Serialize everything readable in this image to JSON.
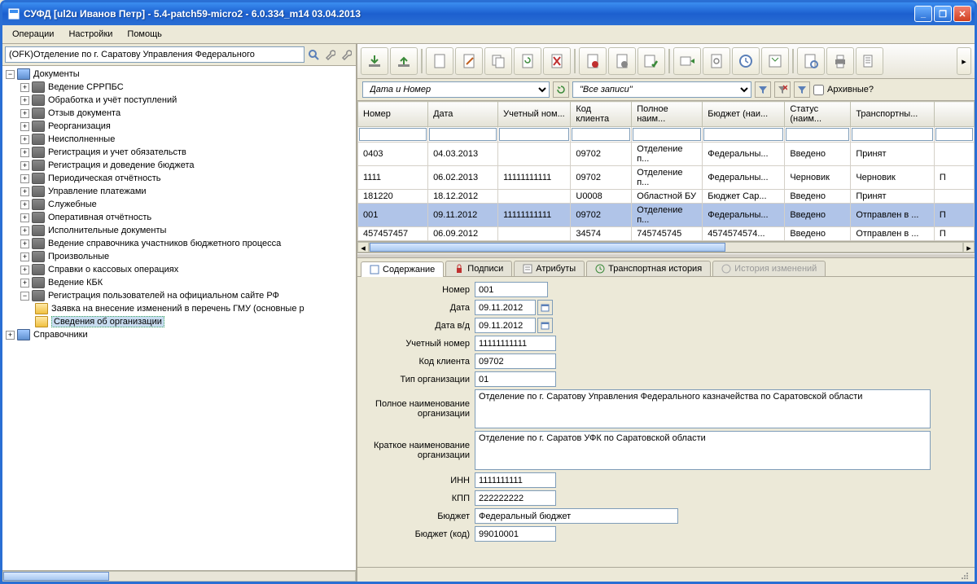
{
  "window": {
    "title": "СУФД [ul2u Иванов Петр] - 5.4-patch59-micro2 - 6.0.334_m14 03.04.2013"
  },
  "menu": {
    "items": [
      "Операции",
      "Настройки",
      "Помощь"
    ]
  },
  "nav": {
    "breadcrumb": "(OFK)Отделение по г. Саратову Управления Федерального",
    "tree": {
      "root0": {
        "label": "Документы"
      },
      "items": [
        {
          "label": "Ведение СРРПБС"
        },
        {
          "label": "Обработка и учёт поступлений"
        },
        {
          "label": "Отзыв документа"
        },
        {
          "label": "Реорганизация"
        },
        {
          "label": "Неисполненные"
        },
        {
          "label": "Регистрация и учет обязательств"
        },
        {
          "label": "Регистрация и доведение бюджета"
        },
        {
          "label": "Периодическая отчётность"
        },
        {
          "label": "Управление платежами"
        },
        {
          "label": "Служебные"
        },
        {
          "label": "Оперативная отчётность"
        },
        {
          "label": "Исполнительные документы"
        },
        {
          "label": "Ведение справочника участников бюджетного процесса"
        },
        {
          "label": "Произвольные"
        },
        {
          "label": "Справки о кассовых операциях"
        },
        {
          "label": "Ведение КБК"
        },
        {
          "label": "Регистрация пользователей на официальном сайте РФ"
        }
      ],
      "subitems": [
        {
          "label": "Заявка на внесение изменений в перечень ГМУ (основные р"
        },
        {
          "label": "Сведения об организации"
        }
      ],
      "root1": {
        "label": "Справочники"
      }
    }
  },
  "filter": {
    "by": "Дата и Номер",
    "preset": "\"Все записи\"",
    "archive_label": "Архивные?"
  },
  "grid": {
    "cols": [
      "Номер",
      "Дата",
      "Учетный ном...",
      "Код клиента",
      "Полное наим...",
      "Бюджет (наи...",
      "Статус (наим...",
      "Транспортны..."
    ],
    "rows": [
      {
        "num": "0403",
        "date": "04.03.2013",
        "acct": "",
        "client": "09702",
        "name": "Отделение п...",
        "budget": "Федеральны...",
        "status": "Введено",
        "trans": "Принят",
        "e": ""
      },
      {
        "num": "1111",
        "date": "06.02.2013",
        "acct": "11111111111",
        "client": "09702",
        "name": "Отделение п...",
        "budget": "Федеральны...",
        "status": "Черновик",
        "trans": "Черновик",
        "e": "П"
      },
      {
        "num": "181220",
        "date": "18.12.2012",
        "acct": "",
        "client": "U0008",
        "name": "Областной БУ",
        "budget": "Бюджет Сар...",
        "status": "Введено",
        "trans": "Принят",
        "e": ""
      },
      {
        "num": "001",
        "date": "09.11.2012",
        "acct": "11111111111",
        "client": "09702",
        "name": "Отделение п...",
        "budget": "Федеральны...",
        "status": "Введено",
        "trans": "Отправлен в ...",
        "e": "П"
      },
      {
        "num": "457457457",
        "date": "06.09.2012",
        "acct": "",
        "client": "34574",
        "name": "745745745",
        "budget": "4574574574...",
        "status": "Введено",
        "trans": "Отправлен в ...",
        "e": "П"
      }
    ]
  },
  "tabs": {
    "t0": "Содержание",
    "t1": "Подписи",
    "t2": "Атрибуты",
    "t3": "Транспортная история",
    "t4": "История изменений"
  },
  "form": {
    "labels": {
      "num": "Номер",
      "date": "Дата",
      "date_vd": "Дата в/д",
      "acct": "Учетный номер",
      "client": "Код клиента",
      "org_type": "Тип организации",
      "full_name": "Полное наименование организации",
      "short_name": "Краткое наименование организации",
      "inn": "ИНН",
      "kpp": "КПП",
      "budget": "Бюджет",
      "budget_code": "Бюджет (код)"
    },
    "values": {
      "num": "001",
      "date": "09.11.2012",
      "date_vd": "09.11.2012",
      "acct": "11111111111",
      "client": "09702",
      "org_type": "01",
      "full_name": "Отделение по г. Саратову Управления Федерального казначейства по Саратовской области",
      "short_name": "Отделение по г. Саратов УФК по Саратовской области",
      "inn": "1111111111",
      "kpp": "222222222",
      "budget": "Федеральный бюджет",
      "budget_code": "99010001"
    }
  }
}
